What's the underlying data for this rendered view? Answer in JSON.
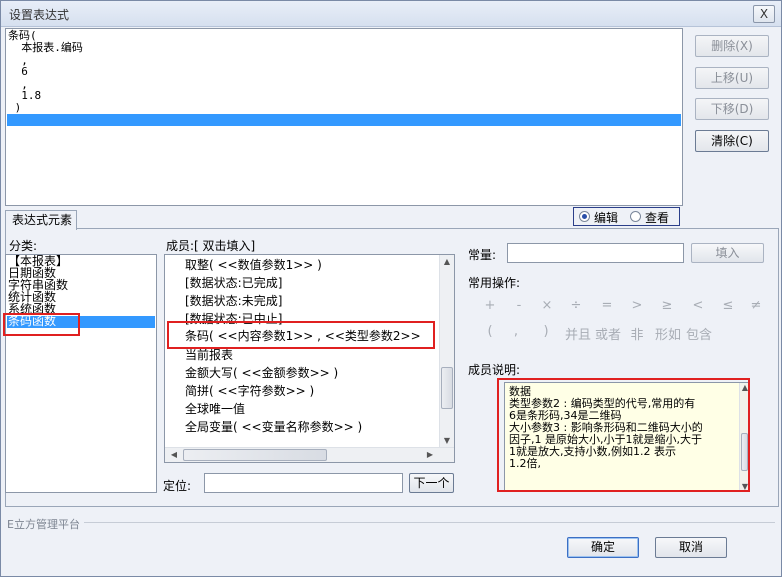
{
  "window": {
    "title": "设置表达式",
    "close_label": "X"
  },
  "expression": {
    "lines": [
      "条码(",
      "  本报表.编码",
      "  ,",
      "  6",
      "  ,",
      "  1.8",
      " )",
      ""
    ]
  },
  "side_buttons": {
    "delete": "删除(X)",
    "up": "上移(U)",
    "down": "下移(D)",
    "clear": "清除(C)"
  },
  "tab": {
    "label": "表达式元素"
  },
  "mode": {
    "edit": "编辑",
    "view": "查看",
    "selected": "edit"
  },
  "category": {
    "label": "分类:",
    "items": [
      "【本报表】",
      "日期函数",
      "字符串函数",
      "统计函数",
      "系统函数",
      "条码函数"
    ],
    "selected_index": 5
  },
  "members": {
    "label": "成员:[ 双击填入]",
    "items": [
      "取整( <<数值参数1>> )",
      "[数据状态:已完成]",
      "[数据状态:未完成]",
      "[数据状态:已中止]",
      "条码( <<内容参数1>>  , <<类型参数2>>",
      "当前报表",
      "金额大写( <<金额参数>> )",
      "简拼( <<字符参数>> )",
      "全球唯一值",
      "全局变量( <<变量名称参数>> )"
    ]
  },
  "locate": {
    "label": "定位:",
    "value": "",
    "next_button": "下一个"
  },
  "constant": {
    "label": "常量:",
    "value": "",
    "fill_button": "填入"
  },
  "common_ops": {
    "label": "常用操作:",
    "row1": [
      "+",
      "-",
      "×",
      "÷",
      "=",
      ">",
      "≥",
      "<",
      "≤",
      "≠"
    ],
    "row2": [
      "(",
      ",",
      ")",
      "并且",
      "或者",
      "非",
      "形如",
      "包含"
    ]
  },
  "member_desc": {
    "label": "成员说明:",
    "lines": [
      "数据",
      "类型参数2 : 编码类型的代号,常用的有",
      "6是条形码,34是二维码",
      "大小参数3 : 影响条形码和二维码大小的",
      "因子,1 是原始大小,小于1就是缩小,大于",
      "1就是放大,支持小数,例如1.2 表示",
      "1.2倍,"
    ]
  },
  "footer": {
    "brand": "E立方管理平台",
    "ok": "确定",
    "cancel": "取消"
  },
  "colors": {
    "selection": "#3399ff",
    "highlight_border": "#e02020",
    "radio_box_border": "#2b3f8a"
  }
}
